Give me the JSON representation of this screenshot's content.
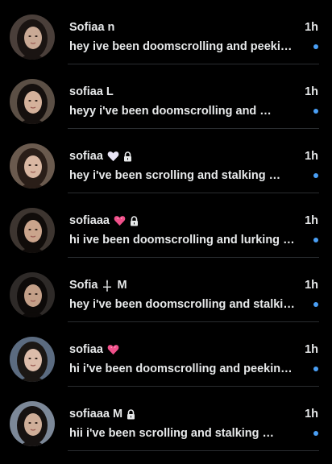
{
  "conversations": [
    {
      "name": "Sofiaa n",
      "time": "1h",
      "preview": "hey ive been doomscrolling and peekin…",
      "badges": [],
      "unread": true,
      "avatar": {
        "bg": "#4a3f3a",
        "hair": "#1a1412",
        "skin": "#c9a995"
      }
    },
    {
      "name": "sofiaa L",
      "time": "1h",
      "preview": "heyy i've been doomscrolling and …",
      "badges": [],
      "unread": true,
      "avatar": {
        "bg": "#5b4f45",
        "hair": "#15100e",
        "skin": "#d4b19b"
      }
    },
    {
      "name": "sofiaa",
      "time": "1h",
      "preview": "hey i've been scrolling and stalking …",
      "badges": [
        "white-heart-icon",
        "lock-icon"
      ],
      "unread": true,
      "avatar": {
        "bg": "#6a5a4e",
        "hair": "#2a1e18",
        "skin": "#d9b7a2"
      }
    },
    {
      "name": "sofiaaa",
      "time": "1h",
      "preview": "hi ive been doomscrolling and lurking o…",
      "badges": [
        "pink-heart-icon",
        "lock-icon"
      ],
      "unread": true,
      "avatar": {
        "bg": "#3d3530",
        "hair": "#100c0a",
        "skin": "#caa48c"
      }
    },
    {
      "name": "Sofia",
      "nameSuffix": "M",
      "time": "1h",
      "preview": "hey i've been doomscrolling and stalki…",
      "badges": [
        "dagger-icon"
      ],
      "unread": true,
      "avatar": {
        "bg": "#2e2a28",
        "hair": "#0d0a09",
        "skin": "#c39f88"
      }
    },
    {
      "name": "sofiaa",
      "time": "1h",
      "preview": "hi i've been doomscrolling and peeking…",
      "badges": [
        "pink-heart-icon"
      ],
      "unread": true,
      "avatar": {
        "bg": "#5b6b80",
        "hair": "#1b1714",
        "skin": "#dcbcaa"
      }
    },
    {
      "name": "sofiaaa M",
      "time": "1h",
      "preview": "hii i've been scrolling and stalking …",
      "badges": [
        "lock-icon"
      ],
      "unread": true,
      "avatar": {
        "bg": "#7c8898",
        "hair": "#161211",
        "skin": "#cfae99"
      }
    }
  ],
  "colors": {
    "background": "#000000",
    "text": "#e7e9ea",
    "unread_dot": "#4a9ff5",
    "divider": "#2a2d30",
    "pink_heart": "#f0508a",
    "white_heart": "#e8e4f4"
  }
}
